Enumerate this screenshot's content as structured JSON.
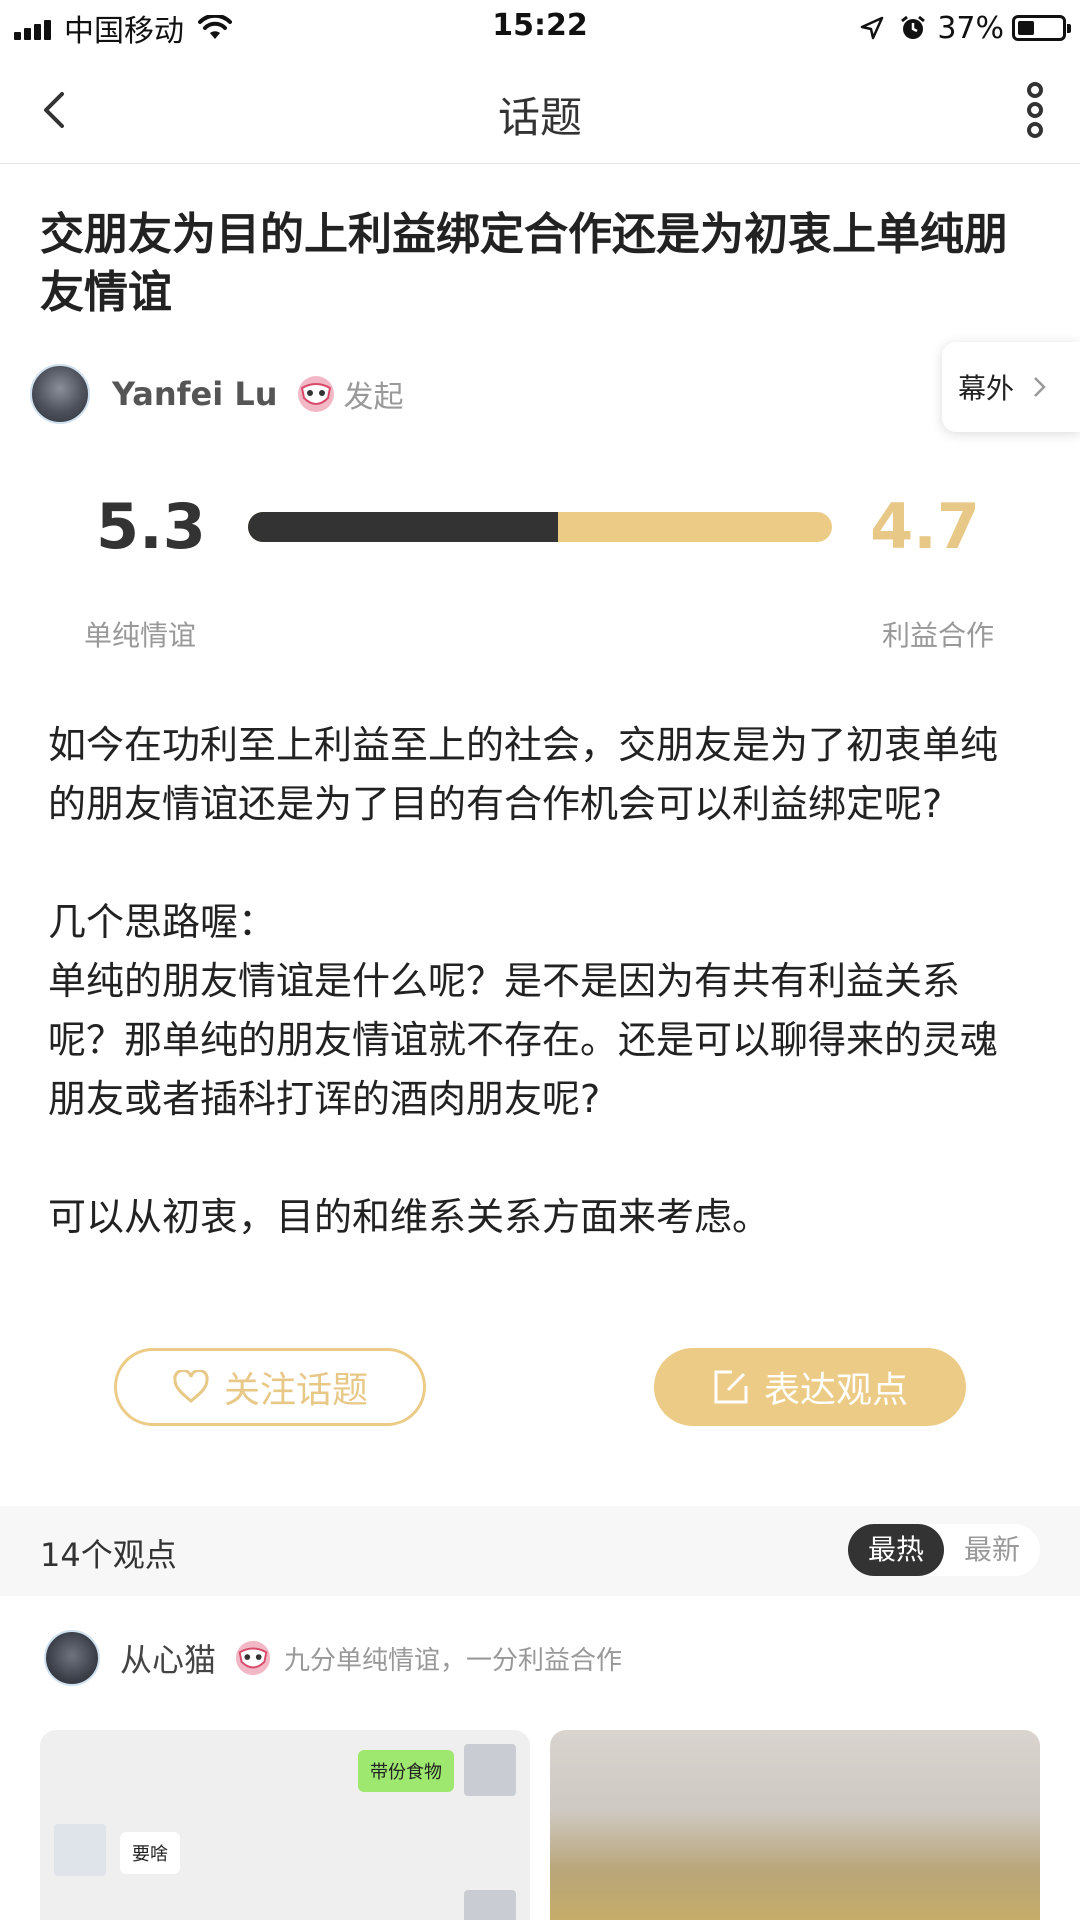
{
  "status_bar": {
    "carrier": "中国移动",
    "time": "15:22",
    "battery": "37%",
    "battery_level": 0.37
  },
  "nav": {
    "title": "话题"
  },
  "topic": {
    "title": "交朋友为目的上利益绑定合作还是为初衷上单纯朋友情谊",
    "author": "Yanfei Lu",
    "action": "发起",
    "side_tab": "幕外"
  },
  "vote": {
    "left_score": "5.3",
    "right_score": "4.7",
    "left_label": "单纯情谊",
    "right_label": "利益合作",
    "left_fraction": 0.53,
    "colors": {
      "left": "#333333",
      "right": "#eccb86"
    }
  },
  "description": [
    "如今在功利至上利益至上的社会，交朋友是为了初衷单纯的朋友情谊还是为了目的有合作机会可以利益绑定呢?",
    "",
    "几个思路喔：\n单纯的朋友情谊是什么呢？是不是因为有共有利益关系呢？那单纯的朋友情谊就不存在。还是可以聊得来的灵魂朋友或者插科打诨的酒肉朋友呢?",
    "",
    "可以从初衷，目的和维系关系方面来考虑。"
  ],
  "actions": {
    "follow": "关注话题",
    "express": "表达观点"
  },
  "opinions": {
    "count_label": "14个观点",
    "sort_hot": "最热",
    "sort_new": "最新",
    "first": {
      "user": "从心猫",
      "stance": "九分单纯情谊，一分利益合作",
      "chat_lines": [
        "带份食物",
        "要啥"
      ]
    }
  }
}
